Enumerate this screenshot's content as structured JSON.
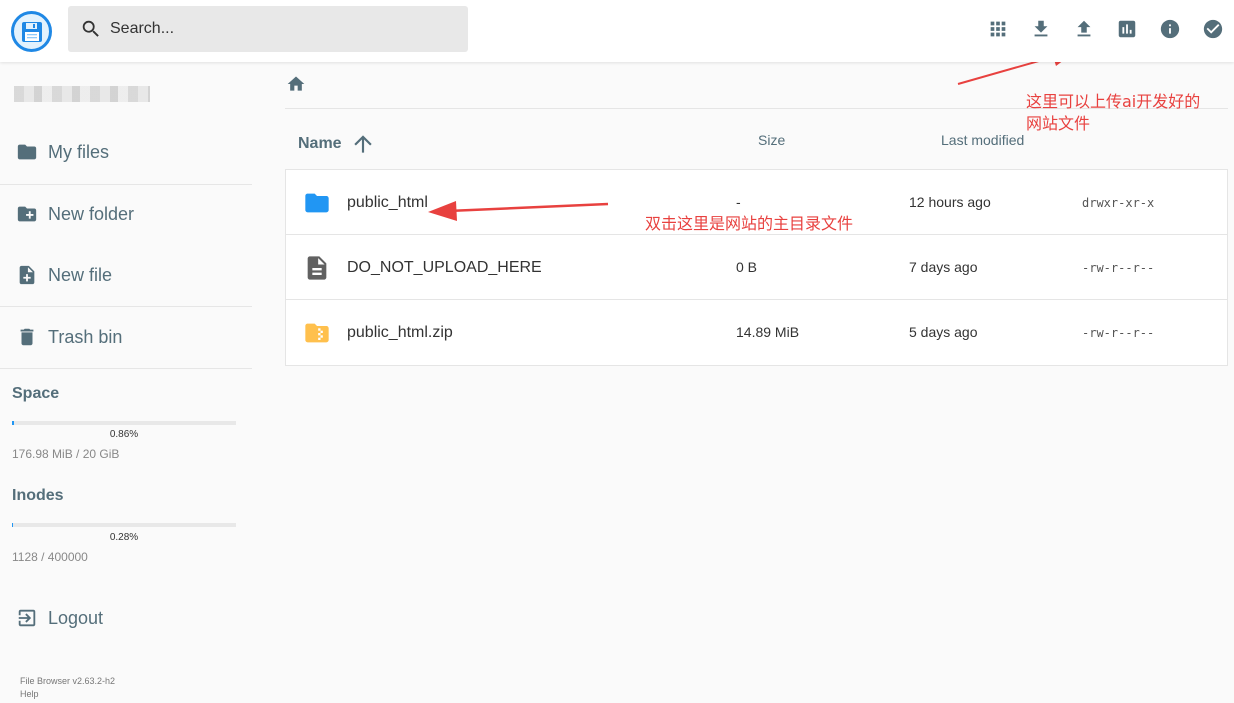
{
  "header": {
    "search_placeholder": "Search...",
    "actions": [
      "view-grid-icon",
      "download-icon",
      "upload-icon",
      "stats-icon",
      "info-icon",
      "check-circle-icon"
    ]
  },
  "sidebar": {
    "nav": {
      "my_files": "My files",
      "new_folder": "New folder",
      "new_file": "New file",
      "trash": "Trash bin",
      "logout": "Logout"
    },
    "space": {
      "label": "Space",
      "percent_text": "0.86%",
      "percent": 0.86,
      "usage": "176.98 MiB / 20 GiB"
    },
    "inodes": {
      "label": "Inodes",
      "percent_text": "0.28%",
      "percent": 0.28,
      "usage": "1128 / 400000"
    },
    "footer": {
      "version": "File Browser v2.63.2-h2",
      "help": "Help"
    }
  },
  "main": {
    "columns": {
      "name": "Name",
      "size": "Size",
      "modified": "Last modified"
    },
    "files": [
      {
        "name": "public_html",
        "size": "-",
        "modified": "12 hours ago",
        "perm": "drwxr-xr-x",
        "icon": "folder-icon"
      },
      {
        "name": "DO_NOT_UPLOAD_HERE",
        "size": "0 B",
        "modified": "7 days ago",
        "perm": "-rw-r--r--",
        "icon": "file-icon"
      },
      {
        "name": "public_html.zip",
        "size": "14.89 MiB",
        "modified": "5 days ago",
        "perm": "-rw-r--r--",
        "icon": "zip-folder-icon"
      }
    ]
  },
  "annotations": {
    "upload_note_line1": "这里可以上传ai开发好的",
    "upload_note_line2": "网站文件",
    "folder_note": "双击这里是网站的主目录文件"
  },
  "colors": {
    "accent": "#1f88e5",
    "icon_grey": "#546e7a",
    "annotation_red": "#e8413f",
    "folder_blue": "#2196f3",
    "zip_amber": "#ffc04d"
  }
}
